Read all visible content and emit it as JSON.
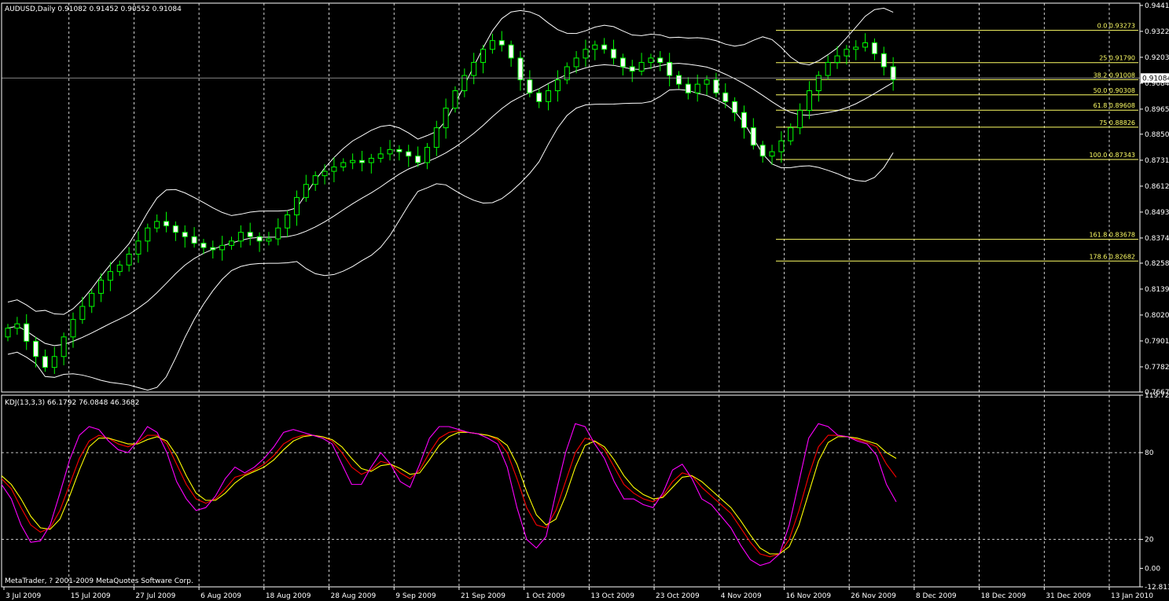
{
  "window": {
    "symbol_info": "AUDUSD,Daily  0.91082 0.91452 0.90552 0.91084",
    "indicator_info": "KDJ(13,3,3) 66.1792 76.0848 46.3682",
    "copyright": "MetaTrader, ? 2001-2009 MetaQuotes Software Corp.",
    "current_price_label": "0.91084"
  },
  "colors": {
    "background": "#000000",
    "candle_up": "#000000",
    "candle_down": "#ffffff",
    "candle_outline": "#00ff00",
    "bollinger": "#ffffff",
    "fibonacci": "#ffff66",
    "k_line": "#ff0000",
    "d_line": "#ffff00",
    "j_line": "#ff00ff",
    "grid": "#ffffff"
  },
  "chart_data": [
    {
      "type": "candlestick",
      "title": "AUDUSD,Daily",
      "y_ticks": [
        "0.94415",
        "0.93225",
        "0.92035",
        "0.90845",
        "0.89655",
        "0.88505",
        "0.87310",
        "0.86120",
        "0.84930",
        "0.83740",
        "0.82585",
        "0.81395",
        "0.80205",
        "0.79015",
        "0.77825",
        "0.76670"
      ],
      "ylim": [
        0.7667,
        0.9452
      ],
      "x_ticks": [
        "3 Jul 2009",
        "15 Jul 2009",
        "27 Jul 2009",
        "6 Aug 2009",
        "18 Aug 2009",
        "28 Aug 2009",
        "9 Sep 2009",
        "21 Sep 2009",
        "1 Oct 2009",
        "13 Oct 2009",
        "23 Oct 2009",
        "4 Nov 2009",
        "16 Nov 2009",
        "26 Nov 2009",
        "8 Dec 2009",
        "18 Dec 2009",
        "31 Dec 2009",
        "13 Jan 2010"
      ],
      "grid": "vertical dashed at date ticks",
      "close_path": [
        0.796,
        0.798,
        0.79,
        0.783,
        0.778,
        0.783,
        0.792,
        0.8,
        0.806,
        0.812,
        0.818,
        0.822,
        0.825,
        0.83,
        0.836,
        0.842,
        0.845,
        0.843,
        0.84,
        0.838,
        0.835,
        0.833,
        0.832,
        0.834,
        0.836,
        0.84,
        0.838,
        0.836,
        0.837,
        0.842,
        0.848,
        0.856,
        0.862,
        0.866,
        0.868,
        0.87,
        0.872,
        0.873,
        0.872,
        0.874,
        0.876,
        0.878,
        0.877,
        0.875,
        0.872,
        0.879,
        0.888,
        0.897,
        0.905,
        0.912,
        0.918,
        0.924,
        0.928,
        0.926,
        0.92,
        0.91,
        0.904,
        0.9,
        0.905,
        0.91,
        0.916,
        0.92,
        0.924,
        0.926,
        0.924,
        0.92,
        0.916,
        0.914,
        0.918,
        0.92,
        0.918,
        0.912,
        0.908,
        0.904,
        0.908,
        0.91,
        0.904,
        0.9,
        0.895,
        0.888,
        0.88,
        0.875,
        0.877,
        0.882,
        0.888,
        0.896,
        0.905,
        0.912,
        0.918,
        0.921,
        0.924,
        0.925,
        0.927,
        0.922,
        0.916,
        0.91
      ],
      "fibonacci_levels": [
        {
          "label": "0.0  0.93273",
          "value": 0.93273
        },
        {
          "label": "25  0.91790",
          "value": 0.9179
        },
        {
          "label": "38.2  0.91008",
          "value": 0.91008
        },
        {
          "label": "50.0  0.90308",
          "value": 0.90308
        },
        {
          "label": "61.8  0.89608",
          "value": 0.89608
        },
        {
          "label": "75  0.88826",
          "value": 0.88826
        },
        {
          "label": "100.0  0.87343",
          "value": 0.87343
        },
        {
          "label": "161.8  0.83678",
          "value": 0.83678
        },
        {
          "label": "178.6  0.82682",
          "value": 0.82682
        }
      ],
      "current_price": 0.91084
    },
    {
      "type": "line",
      "title": "KDJ(13,3,3)",
      "y_ticks": [
        "119.724",
        "80",
        "20",
        "0.00",
        "-12.8133"
      ],
      "ylim": [
        -12.8133,
        119.724
      ],
      "series": [
        {
          "name": "K",
          "values": [
            62,
            55,
            42,
            30,
            25,
            28,
            40,
            58,
            76,
            88,
            92,
            90,
            86,
            84,
            87,
            92,
            92,
            86,
            72,
            58,
            48,
            45,
            48,
            55,
            63,
            65,
            68,
            72,
            78,
            86,
            90,
            92,
            92,
            91,
            88,
            80,
            70,
            65,
            68,
            74,
            72,
            66,
            62,
            68,
            80,
            90,
            94,
            95,
            94,
            93,
            92,
            89,
            80,
            62,
            42,
            30,
            28,
            40,
            60,
            80,
            90,
            88,
            82,
            70,
            58,
            52,
            48,
            46,
            50,
            60,
            66,
            64,
            56,
            50,
            44,
            38,
            28,
            18,
            10,
            8,
            10,
            20,
            40,
            64,
            84,
            92,
            92,
            91,
            89,
            87,
            84,
            72,
            63
          ]
        },
        {
          "name": "D",
          "values": [
            64,
            58,
            48,
            36,
            28,
            27,
            34,
            50,
            68,
            84,
            90,
            90,
            88,
            86,
            86,
            89,
            91,
            88,
            78,
            64,
            52,
            47,
            47,
            52,
            59,
            64,
            67,
            70,
            75,
            82,
            88,
            91,
            92,
            91,
            89,
            84,
            76,
            69,
            67,
            71,
            72,
            69,
            65,
            66,
            75,
            85,
            91,
            94,
            94,
            93,
            92,
            90,
            85,
            72,
            53,
            37,
            30,
            34,
            50,
            70,
            85,
            88,
            84,
            75,
            64,
            56,
            51,
            48,
            49,
            56,
            63,
            64,
            60,
            54,
            48,
            42,
            33,
            23,
            14,
            10,
            10,
            15,
            30,
            52,
            74,
            87,
            91,
            91,
            90,
            88,
            86,
            80,
            76
          ]
        },
        {
          "name": "J",
          "values": [
            58,
            48,
            30,
            18,
            19,
            30,
            52,
            75,
            92,
            98,
            96,
            88,
            82,
            80,
            88,
            98,
            94,
            80,
            60,
            48,
            40,
            42,
            50,
            62,
            70,
            66,
            70,
            76,
            84,
            94,
            96,
            94,
            92,
            90,
            86,
            72,
            58,
            58,
            70,
            80,
            72,
            60,
            56,
            72,
            90,
            98,
            98,
            96,
            94,
            93,
            90,
            86,
            70,
            42,
            20,
            14,
            22,
            52,
            80,
            100,
            98,
            86,
            76,
            60,
            48,
            48,
            44,
            42,
            52,
            68,
            72,
            62,
            48,
            44,
            36,
            28,
            16,
            6,
            2,
            4,
            10,
            30,
            60,
            90,
            100,
            98,
            92,
            91,
            88,
            86,
            78,
            58,
            46
          ]
        }
      ]
    }
  ]
}
